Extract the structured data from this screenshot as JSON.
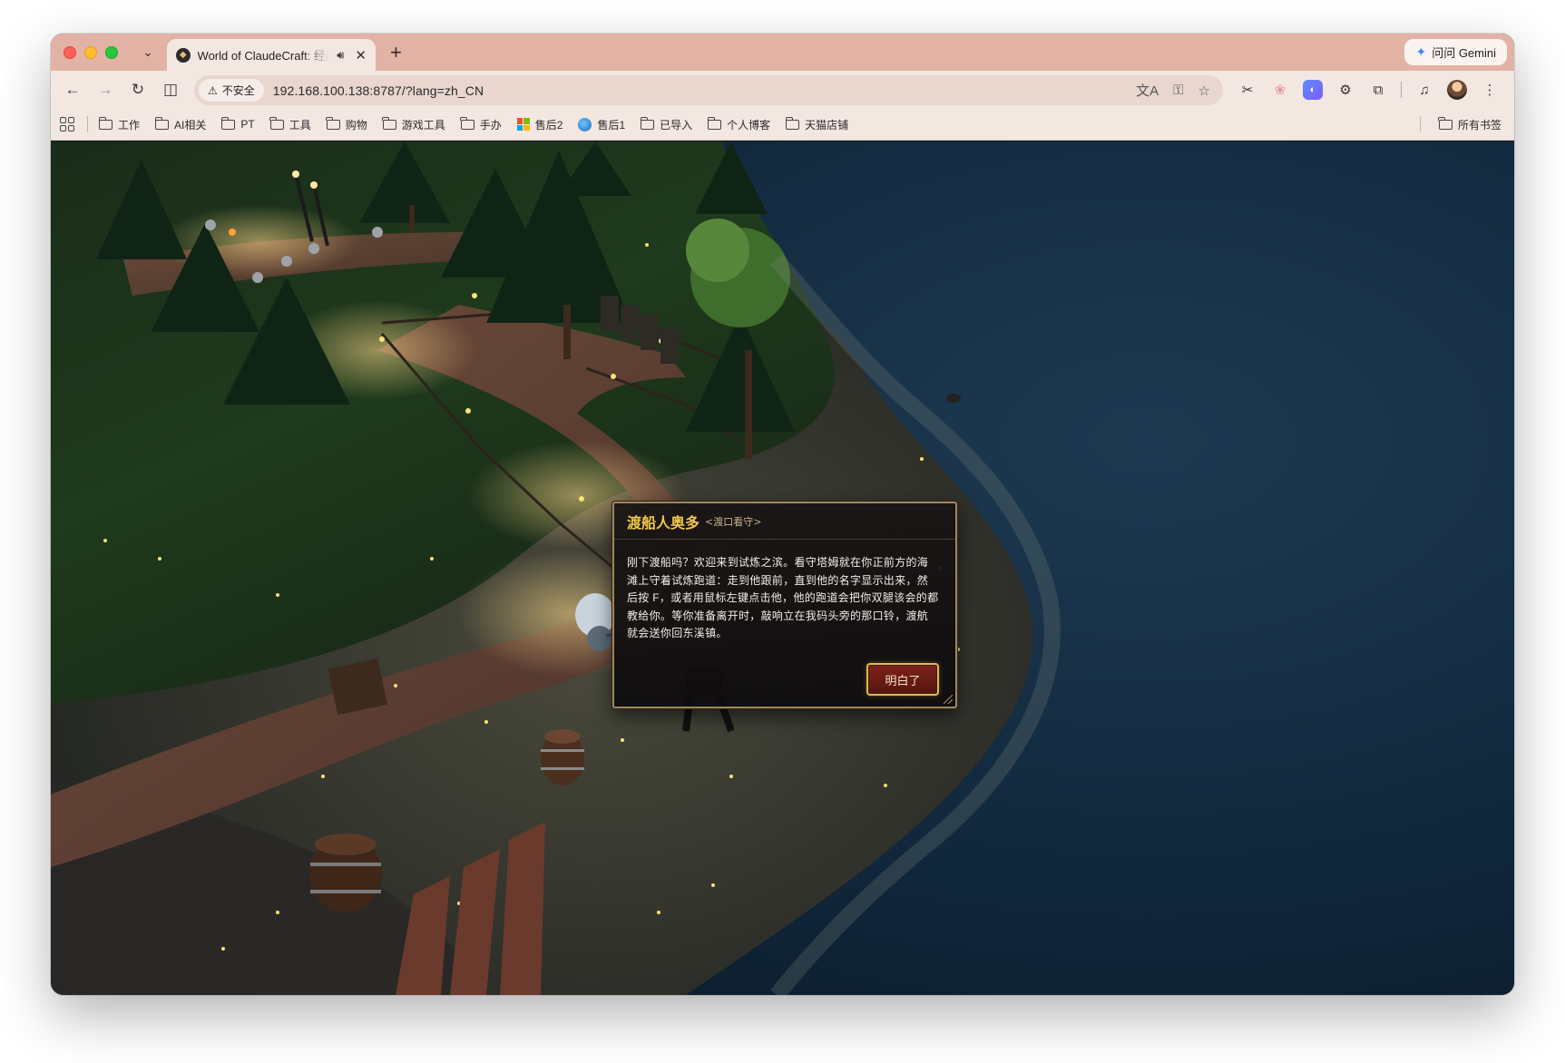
{
  "browser": {
    "tab": {
      "title": "World of ClaudeCraft: 经典",
      "audio_icon": "speaker-icon",
      "close_glyph": "✕"
    },
    "new_tab_glyph": "+",
    "gemini_label": "问问 Gemini",
    "security_label": "不安全",
    "url": "192.168.100.138:8787/?lang=zh_CN",
    "nav": {
      "back": "←",
      "forward": "→",
      "reload": "↻",
      "split": "◫"
    },
    "bookmarks": [
      {
        "label": "工作",
        "icon": "folder-icon"
      },
      {
        "label": "AI相关",
        "icon": "folder-icon"
      },
      {
        "label": "PT",
        "icon": "folder-icon"
      },
      {
        "label": "工具",
        "icon": "folder-icon"
      },
      {
        "label": "购物",
        "icon": "folder-icon"
      },
      {
        "label": "游戏工具",
        "icon": "folder-icon"
      },
      {
        "label": "手办",
        "icon": "folder-icon"
      },
      {
        "label": "售后2",
        "icon": "microsoft-icon"
      },
      {
        "label": "售后1",
        "icon": "globe-icon"
      },
      {
        "label": "已导入",
        "icon": "folder-icon"
      },
      {
        "label": "个人博客",
        "icon": "folder-icon"
      },
      {
        "label": "天猫店铺",
        "icon": "folder-icon"
      }
    ],
    "all_bookmarks_label": "所有书签",
    "colors": {
      "tabstrip": "#e2b3a4",
      "toolbar": "#f3e7e2",
      "omnibox": "#e8d6cf"
    }
  },
  "game": {
    "dialog": {
      "npc_name": "渡船人奥多",
      "npc_subtitle": "<渡口看守>",
      "lines": [
        "刚下渡船吗？欢迎来到试炼之滨。看守塔姆就在你正前方的海",
        "滩上守着试炼跑道：走到他跟前，直到他的名字显示出来，然",
        "后按 F，或者用鼠标左键点击他，他的跑道会把你双腿该会的都",
        "教给你。等你准备离开时，敲响立在我码头旁的那口铃，渡航",
        "就会送你回东溪镇。"
      ],
      "confirm_label": "明白了",
      "colors": {
        "title": "#f1c74a",
        "border": "#a0875a",
        "button": "#7e2219"
      }
    }
  }
}
